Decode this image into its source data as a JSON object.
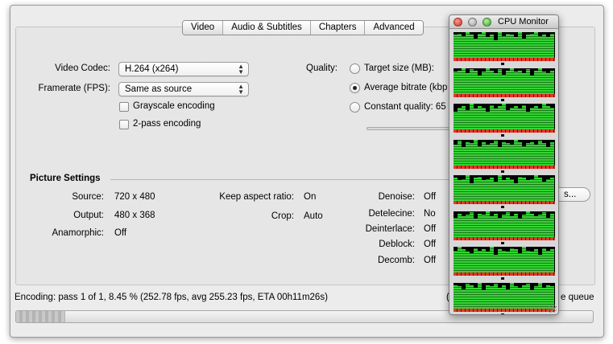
{
  "tabs": [
    {
      "label": "Video",
      "active": true
    },
    {
      "label": "Audio & Subtitles",
      "active": false
    },
    {
      "label": "Chapters",
      "active": false
    },
    {
      "label": "Advanced",
      "active": false
    }
  ],
  "video": {
    "codec_label": "Video Codec:",
    "codec_value": "H.264 (x264)",
    "framerate_label": "Framerate (FPS):",
    "framerate_value": "Same as source",
    "grayscale_label": "Grayscale encoding",
    "twopass_label": "2-pass encoding"
  },
  "quality": {
    "label": "Quality:",
    "target_size": "Target size (MB):",
    "avg_bitrate": "Average bitrate (kbp",
    "constant_quality": "Constant quality: 65"
  },
  "picture": {
    "heading": "Picture Settings",
    "source_label": "Source:",
    "source_value": "720 x 480",
    "output_label": "Output:",
    "output_value": "480 x 368",
    "anamorphic_label": "Anamorphic:",
    "anamorphic_value": "Off",
    "keep_aspect_label": "Keep aspect ratio:",
    "keep_aspect_value": "On",
    "crop_label": "Crop:",
    "crop_value": "Auto",
    "denoise_label": "Denoise:",
    "denoise_value": "Off",
    "detelecine_label": "Detelecine:",
    "detelecine_value": "No",
    "deinterlace_label": "Deinterlace:",
    "deinterlace_value": "Off",
    "deblock_label": "Deblock:",
    "deblock_value": "Off",
    "decomb_label": "Decomb:",
    "decomb_value": "Off",
    "settings_button": "s..."
  },
  "status": {
    "text": "Encoding: pass 1 of 1, 8.45 % (252.78 fps, avg 255.23 fps, ETA 00h11m26s)",
    "queue_prefix": "(",
    "queue_text": "e queue",
    "progress_fraction": 0.0845
  },
  "cpu_monitor": {
    "title": "CPU Monitor",
    "colors": {
      "active": "#35d435",
      "idle": "#000000",
      "base": "#e03a2a"
    },
    "cores": [
      [
        0.9,
        0.95,
        0.85,
        1,
        0.9,
        0.75,
        0.95,
        1,
        0.8,
        0.9,
        0.7,
        1,
        0.85,
        0.95,
        0.9,
        0.8,
        1,
        0.75,
        0.9,
        0.95,
        1,
        0.85,
        0.9,
        0.8,
        0.95
      ],
      [
        0.85,
        0.9,
        1,
        0.8,
        0.95,
        0.9,
        0.7,
        0.85,
        1,
        0.9,
        0.8,
        0.95,
        0.75,
        0.9,
        1,
        0.85,
        0.9,
        0.8,
        0.95,
        0.7,
        0.9,
        1,
        0.85,
        0.8,
        0.9
      ],
      [
        0.7,
        0.85,
        0.9,
        0.75,
        1,
        0.8,
        0.9,
        0.85,
        0.7,
        0.95,
        0.8,
        0.9,
        1,
        0.75,
        0.85,
        0.9,
        0.8,
        0.95,
        0.7,
        0.85,
        0.9,
        0.8,
        1,
        0.9,
        0.85
      ],
      [
        0.8,
        0.95,
        0.7,
        0.9,
        0.85,
        1,
        0.75,
        0.9,
        0.8,
        0.85,
        0.95,
        0.7,
        0.9,
        0.85,
        0.8,
        1,
        0.9,
        0.75,
        0.85,
        0.9,
        0.8,
        0.95,
        0.85,
        0.7,
        0.9
      ],
      [
        0.9,
        0.8,
        0.85,
        1,
        0.7,
        0.9,
        0.95,
        0.8,
        0.85,
        0.9,
        0.75,
        1,
        0.8,
        0.9,
        0.85,
        0.7,
        0.95,
        0.9,
        0.8,
        0.85,
        1,
        0.9,
        0.75,
        0.85,
        0.9
      ],
      [
        0.75,
        0.9,
        0.8,
        0.85,
        0.95,
        0.7,
        0.9,
        0.85,
        1,
        0.8,
        0.9,
        0.75,
        0.85,
        0.95,
        0.8,
        0.9,
        0.7,
        0.85,
        1,
        0.9,
        0.8,
        0.85,
        0.95,
        0.75,
        0.9
      ],
      [
        0.85,
        1,
        0.9,
        0.8,
        0.75,
        0.95,
        0.85,
        0.9,
        0.8,
        1,
        0.7,
        0.9,
        0.85,
        0.8,
        0.95,
        0.9,
        0.75,
        1,
        0.85,
        0.8,
        0.9,
        0.7,
        0.95,
        0.85,
        0.9
      ],
      [
        0.9,
        0.85,
        0.75,
        0.95,
        0.9,
        0.8,
        1,
        0.7,
        0.9,
        0.85,
        0.95,
        0.8,
        0.9,
        0.75,
        1,
        0.85,
        0.8,
        0.9,
        0.95,
        0.7,
        0.85,
        1,
        0.8,
        0.9,
        0.85
      ]
    ]
  }
}
